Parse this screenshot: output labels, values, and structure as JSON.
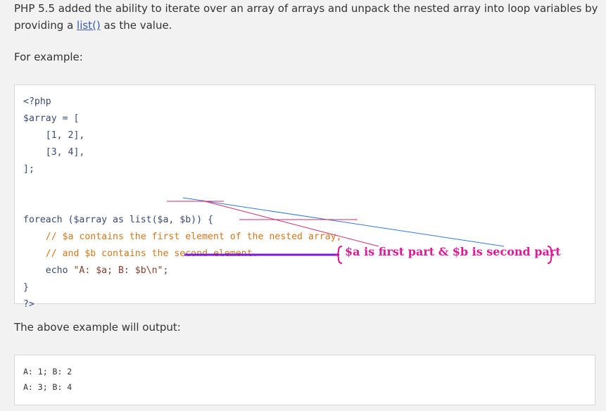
{
  "intro": {
    "text_before": "PHP 5.5 added the ability to iterate over an array of arrays and unpack the nested array into loop variables by providing a ",
    "link": "list()",
    "text_after": " as the value."
  },
  "for_example": "For example:",
  "code_lines": {
    "l1": "<?php",
    "l2": "$array = [",
    "l3": "    [1, 2],",
    "l4": "    [3, 4],",
    "l5": "];",
    "l6": "",
    "l7": "",
    "l8": "foreach ($array as list($a, $b)) {",
    "l9": "    // $a contains the first element of the nested array,",
    "l10": "    // and $b contains the second element.",
    "l11a": "    echo ",
    "l11b": "\"A: $a; B: $b\\n\"",
    "l11c": ";",
    "l12": "}",
    "l13": "?>"
  },
  "output_label": "The above example will output:",
  "output_lines": {
    "o1": "A: 1; B: 2",
    "o2": "A: 3; B: 4"
  },
  "annotation": {
    "text": "$a is first part & $b is second part",
    "colors": {
      "arrow": "#7a1ad6",
      "text": "#e0189a",
      "blue_line": "#2f7ad6",
      "red_line": "#d62a6a"
    }
  }
}
